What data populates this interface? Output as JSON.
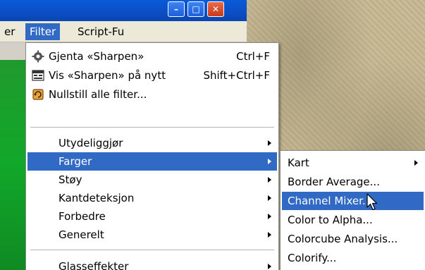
{
  "menubar": {
    "items": [
      {
        "label": "er"
      },
      {
        "label": "Filter"
      },
      {
        "label": "Script-Fu"
      }
    ]
  },
  "filter_menu": {
    "top_items": [
      {
        "label": "Gjenta «Sharpen»",
        "shortcut": "Ctrl+F",
        "icon": "repeat-gear-icon"
      },
      {
        "label": "Vis «Sharpen» på nytt",
        "shortcut": "Shift+Ctrl+F",
        "icon": "reshow-dialog-icon"
      },
      {
        "label": "Nullstill alle filter...",
        "icon": "reset-filters-icon"
      }
    ],
    "submenu_items": [
      {
        "label": "Utydeliggjør"
      },
      {
        "label": "Farger"
      },
      {
        "label": "Støy"
      },
      {
        "label": "Kantdeteksjon"
      },
      {
        "label": "Forbedre"
      },
      {
        "label": "Generelt"
      },
      {
        "label": "Glasseffekter"
      }
    ]
  },
  "farger_menu": {
    "items": [
      {
        "label": "Kart"
      },
      {
        "label": "Border Average..."
      },
      {
        "label": "Channel Mixer..."
      },
      {
        "label": "Color to Alpha..."
      },
      {
        "label": "Colorcube Analysis..."
      },
      {
        "label": "Colorify..."
      }
    ]
  },
  "colors": {
    "selection": "#316ac5",
    "titlebar": "#0a5ad8"
  }
}
